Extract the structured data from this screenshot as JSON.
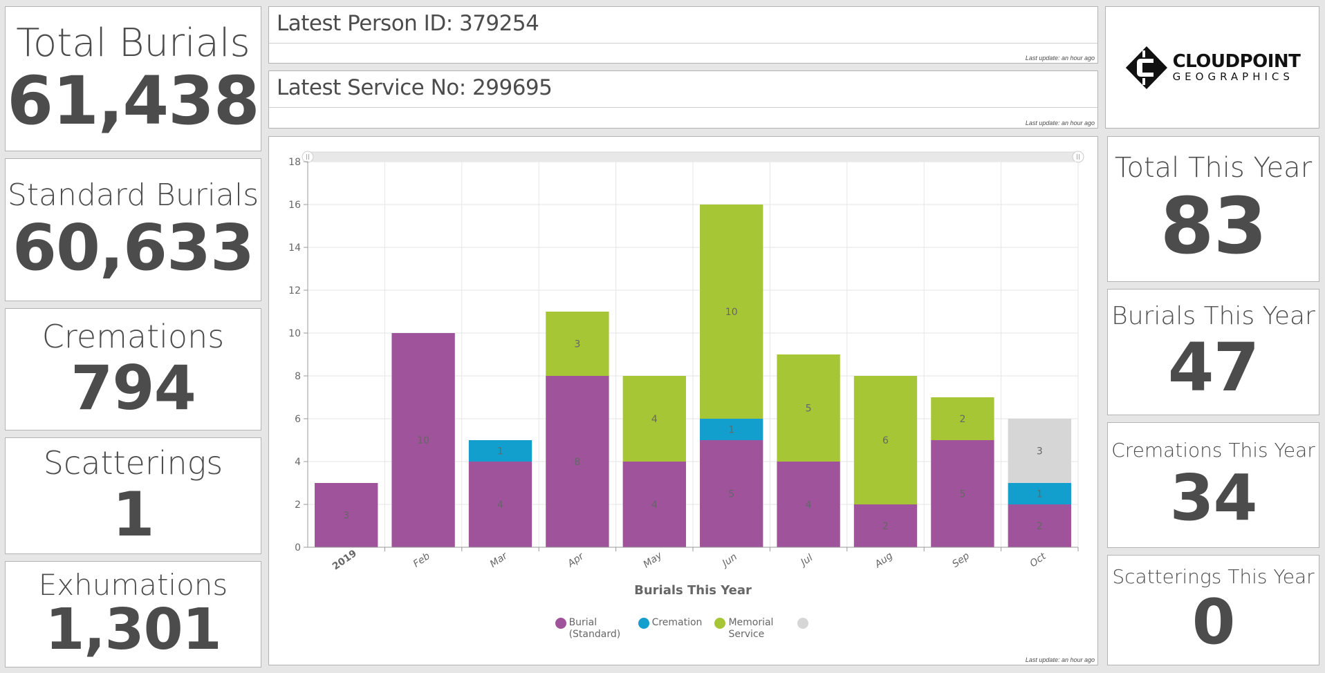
{
  "left_stats": [
    {
      "id": "total",
      "label": "Total Burials",
      "value": "61,438"
    },
    {
      "id": "standard",
      "label": "Standard Burials",
      "value": "60,633"
    },
    {
      "id": "cremations",
      "label": "Cremations",
      "value": "794"
    },
    {
      "id": "scatterings",
      "label": "Scatterings",
      "value": "1"
    },
    {
      "id": "exhumations",
      "label": "Exhumations",
      "value": "1,301"
    }
  ],
  "header": {
    "person": {
      "title": "Latest Person ID: 379254",
      "updated": "Last update: an hour ago"
    },
    "service": {
      "title": "Latest Service No: 299695",
      "updated": "Last update: an hour ago"
    }
  },
  "logo": {
    "line1": "CLOUDPOINT",
    "line2": "GEOGRAPHICS",
    "icon": "cloudpoint-logo-icon"
  },
  "right_stats": [
    {
      "id": "total-this-year",
      "label": "Total This Year",
      "value": "83"
    },
    {
      "id": "burials-this-year",
      "label": "Burials This Year",
      "value": "47"
    },
    {
      "id": "cremations-this-year",
      "label": "Cremations This Year",
      "value": "34"
    },
    {
      "id": "scatterings-this-year",
      "label": "Scatterings This Year",
      "value": "0"
    }
  ],
  "chart_updated": "Last update: an hour ago",
  "chart_data": {
    "type": "bar",
    "stacked": true,
    "title": "",
    "xlabel": "Burials This Year",
    "ylabel": "",
    "ylim": [
      0,
      18
    ],
    "yticks": [
      0,
      2,
      4,
      6,
      8,
      10,
      12,
      14,
      16,
      18
    ],
    "grid": true,
    "legend_position": "bottom",
    "categories": [
      "2019",
      "Feb",
      "Mar",
      "Apr",
      "May",
      "Jun",
      "Jul",
      "Aug",
      "Sep",
      "Oct"
    ],
    "series": [
      {
        "name": "Burial (Standard)",
        "color": "#9e539a",
        "values": [
          3,
          10,
          4,
          8,
          4,
          5,
          4,
          2,
          5,
          2
        ]
      },
      {
        "name": "Cremation",
        "color": "#139fce",
        "values": [
          0,
          0,
          1,
          0,
          0,
          1,
          0,
          0,
          0,
          1
        ]
      },
      {
        "name": "Memorial Service",
        "color": "#a6c636",
        "values": [
          0,
          0,
          0,
          3,
          4,
          10,
          5,
          6,
          2,
          0
        ]
      },
      {
        "name": "",
        "color": "#d6d6d6",
        "values": [
          0,
          0,
          0,
          0,
          0,
          0,
          0,
          0,
          0,
          3
        ]
      }
    ]
  }
}
